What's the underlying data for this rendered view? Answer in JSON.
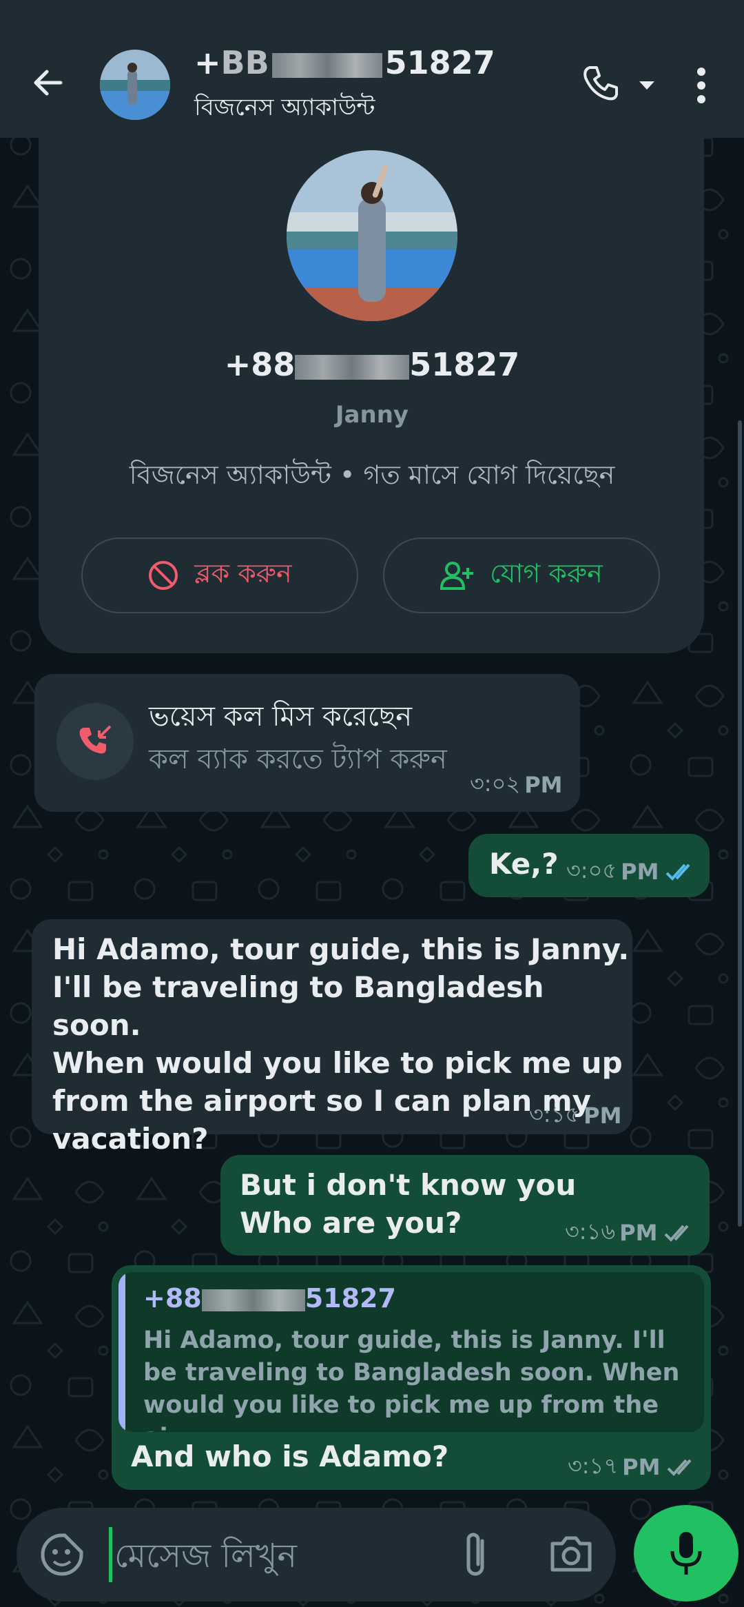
{
  "header": {
    "contact_name": "+88 51827",
    "contact_prefix": "+",
    "contact_suffix": "51827",
    "contact_prefix_partial": "BB",
    "subtitle": "বিজনেস অ্যাকাউন্ট"
  },
  "profile_card": {
    "number_prefix": "+88",
    "number_suffix": "51827",
    "name": "Janny",
    "info": "বিজনেস অ্যাকাউন্ট • গত মাসে যোগ দিয়েছেন",
    "block_label": "ব্লক করুন",
    "add_label": "যোগ করুন"
  },
  "messages": [
    {
      "id": "missed-call",
      "direction": "in",
      "title": "ভয়েস কল মিস করেছেন",
      "subtitle": "কল ব্যাক করতে ট্যাপ করুন",
      "time_digits": "৩:০২",
      "time_ampm": "PM"
    },
    {
      "id": "ke",
      "direction": "out",
      "text": "Ke,?",
      "time_digits": "৩:০৫",
      "time_ampm": "PM",
      "status": "read"
    },
    {
      "id": "janny-intro",
      "direction": "in",
      "text": "Hi Adamo, tour guide, this is Janny. I'll be traveling to Bangladesh soon. When would you like to pick me up from the airport so I can plan my vacation?",
      "lines": [
        "Hi Adamo, tour guide, this is Janny.",
        "I'll be traveling to Bangladesh soon.",
        "When would you like to pick me up",
        "from the airport so I can plan my",
        "vacation?"
      ],
      "time_digits": "৩:১৫",
      "time_ampm": "PM"
    },
    {
      "id": "dont-know",
      "direction": "out",
      "lines": [
        "But i don't know you",
        "Who are you?"
      ],
      "time_digits": "৩:১৬",
      "time_ampm": "PM",
      "status": "delivered"
    },
    {
      "id": "who-adamo",
      "direction": "out",
      "quote_number_prefix": "+88",
      "quote_number_suffix": "51827",
      "quote_lines": [
        "Hi Adamo, tour guide, this is Janny. I'll",
        "be traveling to Bangladesh soon. When",
        "would you like to pick me up from the ai..."
      ],
      "text": "And who is Adamo?",
      "time_digits": "৩:১৭",
      "time_ampm": "PM",
      "status": "delivered"
    }
  ],
  "input": {
    "placeholder": "মেসেজ লিখুন"
  },
  "colors": {
    "header_bg": "#1f2c34",
    "wallpaper": "#0b141a",
    "incoming_bubble": "#1f2c34",
    "outgoing_bubble": "#144d37",
    "accent_green": "#21c063",
    "danger_red": "#f15c6d",
    "read_tick_blue": "#53bdeb"
  },
  "icons": [
    "back-arrow-icon",
    "phone-icon",
    "chevron-down-icon",
    "more-vertical-icon",
    "block-icon",
    "add-contact-icon",
    "missed-call-icon",
    "double-check-icon",
    "sticker-icon",
    "attach-icon",
    "camera-icon",
    "mic-icon"
  ]
}
